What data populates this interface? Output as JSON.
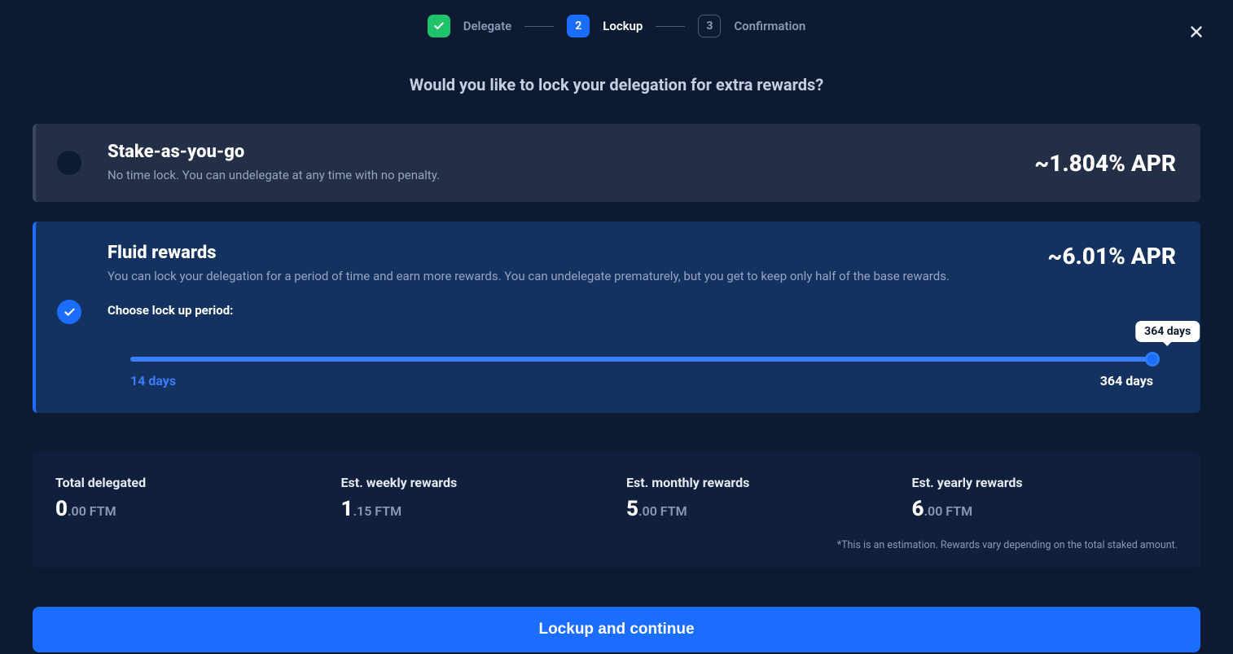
{
  "stepper": {
    "steps": [
      {
        "label": "Delegate",
        "state": "done"
      },
      {
        "label": "Lockup",
        "state": "active",
        "num": "2"
      },
      {
        "label": "Confirmation",
        "state": "pending",
        "num": "3"
      }
    ]
  },
  "headline": "Would you like to lock your delegation for extra rewards?",
  "options": {
    "stake_as_you_go": {
      "title": "Stake-as-you-go",
      "desc": "No time lock. You can undelegate at any time with no penalty.",
      "apr": "~1.804% APR"
    },
    "fluid": {
      "title": "Fluid rewards",
      "desc": "You can lock your delegation for a period of time and earn more rewards. You can undelegate prematurely, but you get to keep only half of the base rewards.",
      "apr": "~6.01% APR",
      "choose_label": "Choose lock up period:",
      "slider": {
        "min_label": "14 days",
        "max_label": "364 days",
        "value_label": "364 days"
      }
    }
  },
  "summary": {
    "cols": [
      {
        "label": "Total delegated",
        "big": "0",
        "rest": ".00 FTM"
      },
      {
        "label": "Est. weekly rewards",
        "big": "1",
        "rest": ".15 FTM"
      },
      {
        "label": "Est. monthly rewards",
        "big": "5",
        "rest": ".00 FTM"
      },
      {
        "label": "Est. yearly rewards",
        "big": "6",
        "rest": ".00 FTM"
      }
    ],
    "disclaimer": "*This is an estimation. Rewards vary depending on the total staked amount."
  },
  "cta_label": "Lockup and continue"
}
